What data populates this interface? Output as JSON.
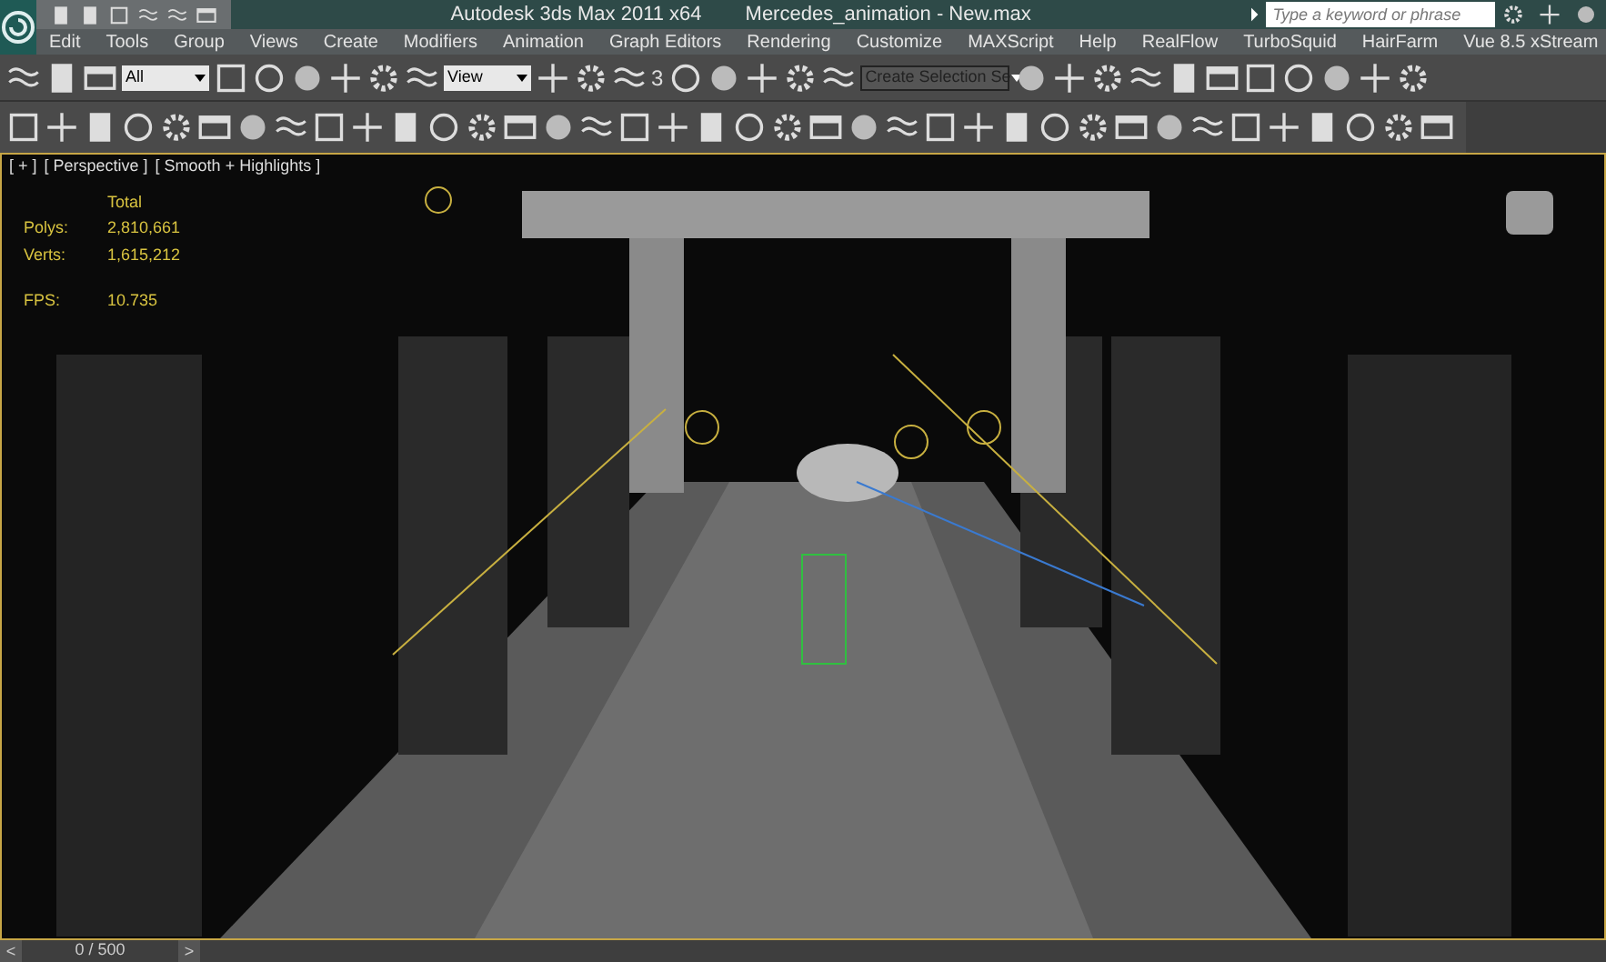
{
  "window": {
    "title": "Autodesk 3ds Max  2011 x64",
    "document": "Mercedes_animation - New.max"
  },
  "search": {
    "placeholder": "Type a keyword or phrase"
  },
  "menu": [
    "Edit",
    "Tools",
    "Group",
    "Views",
    "Create",
    "Modifiers",
    "Animation",
    "Graph Editors",
    "Rendering",
    "Customize",
    "MAXScript",
    "Help",
    "RealFlow",
    "TurboSquid",
    "HairFarm",
    "Vue 8.5 xStream"
  ],
  "toolbar": {
    "selection_filter": "All",
    "reference_coordinate": "View",
    "snap_label": "3",
    "selection_set": "Create Selection Se"
  },
  "viewport": {
    "labels": [
      "[ + ]",
      "[ Perspective ]",
      "[ Smooth + Highlights ]"
    ],
    "stats": {
      "heading": "Total",
      "rows": [
        {
          "label": "Polys:",
          "value": "2,810,661"
        },
        {
          "label": "Verts:",
          "value": "1,615,212"
        }
      ],
      "fps_label": "FPS:",
      "fps_value": "10.735"
    }
  },
  "timeline": {
    "prev": "<",
    "frame": "0 / 500",
    "next": ">"
  }
}
